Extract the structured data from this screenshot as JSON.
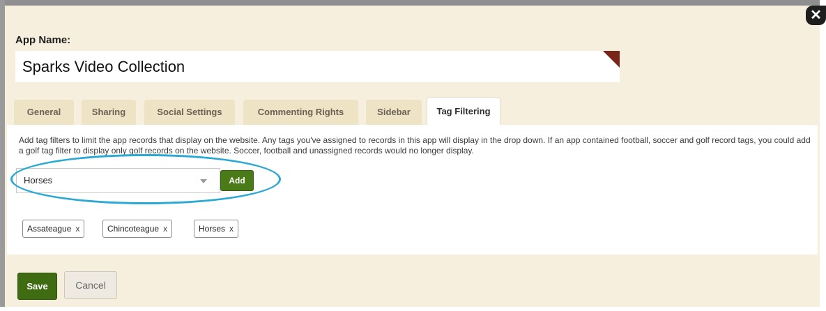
{
  "dialog": {
    "close_icon": "close-icon",
    "close_label": "✕"
  },
  "app_name": {
    "label": "App Name:",
    "value": "Sparks Video Collection"
  },
  "tabs": [
    {
      "label": "General",
      "active": false
    },
    {
      "label": "Sharing",
      "active": false
    },
    {
      "label": "Social Settings",
      "active": false
    },
    {
      "label": "Commenting Rights",
      "active": false
    },
    {
      "label": "Sidebar",
      "active": false
    },
    {
      "label": "Tag Filtering",
      "active": true
    }
  ],
  "tag_filtering": {
    "description": "Add tag filters to limit the app records that display on the website. Any tags you've assigned to records in this app will display in the drop down. If an app contained football, soccer and golf record tags, you could add a golf tag filter to display only golf records on the website. Soccer, football and unassigned records would no longer display.",
    "select_value": "Horses",
    "add_label": "Add",
    "tags": [
      {
        "label": "Assateague",
        "remove": "x"
      },
      {
        "label": "Chincoteague",
        "remove": "x"
      },
      {
        "label": "Horses",
        "remove": "x"
      }
    ]
  },
  "footer": {
    "save_label": "Save",
    "cancel_label": "Cancel"
  },
  "colors": {
    "background": "#f6efdd",
    "primary_button": "#3f6c12",
    "highlight": "#2aa9d4",
    "flag": "#7a2518"
  }
}
